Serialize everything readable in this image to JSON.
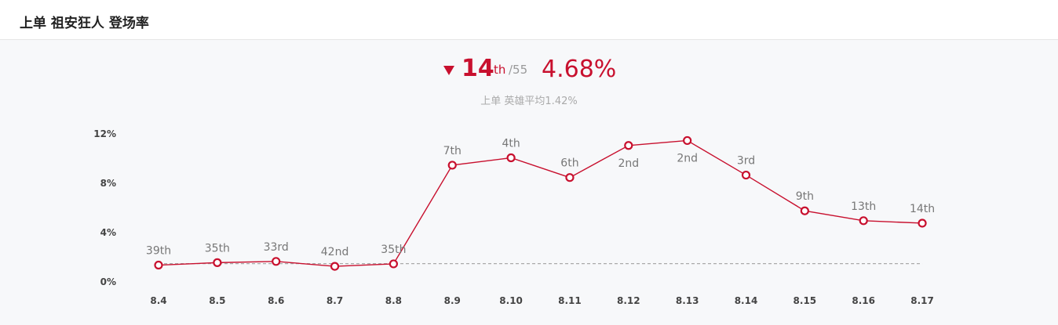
{
  "header": {
    "title": "上单 祖安狂人 登场率"
  },
  "summary": {
    "rank": "14",
    "rank_suffix": "th",
    "rank_total": "/55",
    "rate": "4.68%",
    "avg_text": "上单 英雄平均1.42%",
    "trend": "down"
  },
  "colors": {
    "accent": "#c8102e",
    "avg_line": "#aaaaaa",
    "label": "#777777"
  },
  "chart_data": {
    "type": "line",
    "categories": [
      "8.4",
      "8.5",
      "8.6",
      "8.7",
      "8.8",
      "8.9",
      "8.10",
      "8.11",
      "8.12",
      "8.13",
      "8.14",
      "8.15",
      "8.16",
      "8.17"
    ],
    "values": [
      1.3,
      1.5,
      1.6,
      1.2,
      1.4,
      9.4,
      10.0,
      8.4,
      11.0,
      11.4,
      8.6,
      5.7,
      4.9,
      4.7
    ],
    "point_labels": [
      "39th",
      "35th",
      "33rd",
      "42nd",
      "35th",
      "7th",
      "4th",
      "6th",
      "2nd",
      "2nd",
      "3rd",
      "9th",
      "13th",
      "14th"
    ],
    "label_positions": [
      "above",
      "above",
      "above",
      "above",
      "above",
      "above",
      "above",
      "above",
      "below",
      "below",
      "above",
      "above",
      "above",
      "above"
    ],
    "yticks": [
      0,
      4,
      8,
      12
    ],
    "ytick_labels": [
      "0%",
      "4%",
      "8%",
      "12%"
    ],
    "ylim": [
      0,
      12
    ],
    "average": 1.42,
    "grid": false
  }
}
